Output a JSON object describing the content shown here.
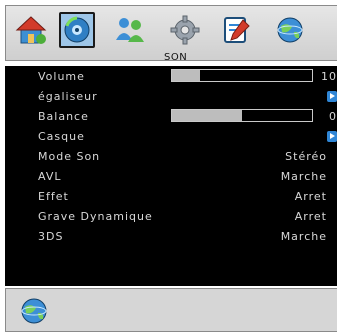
{
  "header": {
    "title": "SON",
    "tabs": [
      {
        "name": "home-icon",
        "selected": false
      },
      {
        "name": "disc-icon",
        "selected": true
      },
      {
        "name": "people-icon",
        "selected": false
      },
      {
        "name": "gear-icon",
        "selected": false
      },
      {
        "name": "notepad-pencil-icon",
        "selected": false
      },
      {
        "name": "globe-icon",
        "selected": false
      }
    ]
  },
  "menu": {
    "items": [
      {
        "label": "Volume",
        "type": "slider",
        "value": "10",
        "level": 0.2
      },
      {
        "label": "égaliseur",
        "type": "submenu"
      },
      {
        "label": "Balance",
        "type": "slider",
        "value": "0",
        "level": 0.5
      },
      {
        "label": "Casque",
        "type": "submenu"
      },
      {
        "label": "Mode Son",
        "type": "option",
        "value": "Stéréo"
      },
      {
        "label": "AVL",
        "type": "option",
        "value": "Marche"
      },
      {
        "label": "Effet",
        "type": "option",
        "value": "Arret"
      },
      {
        "label": "Grave Dynamique",
        "type": "option",
        "value": "Arret"
      },
      {
        "label": "3DS",
        "type": "option",
        "value": "Marche"
      }
    ]
  },
  "footer": {
    "icon": "globe-icon"
  },
  "colors": {
    "panel_background": "#000000",
    "text": "#d8d8d8",
    "slider_fill": "#bdbdbd",
    "arrow": "#2f86d6",
    "selected_tab": "#9ec6e8"
  }
}
